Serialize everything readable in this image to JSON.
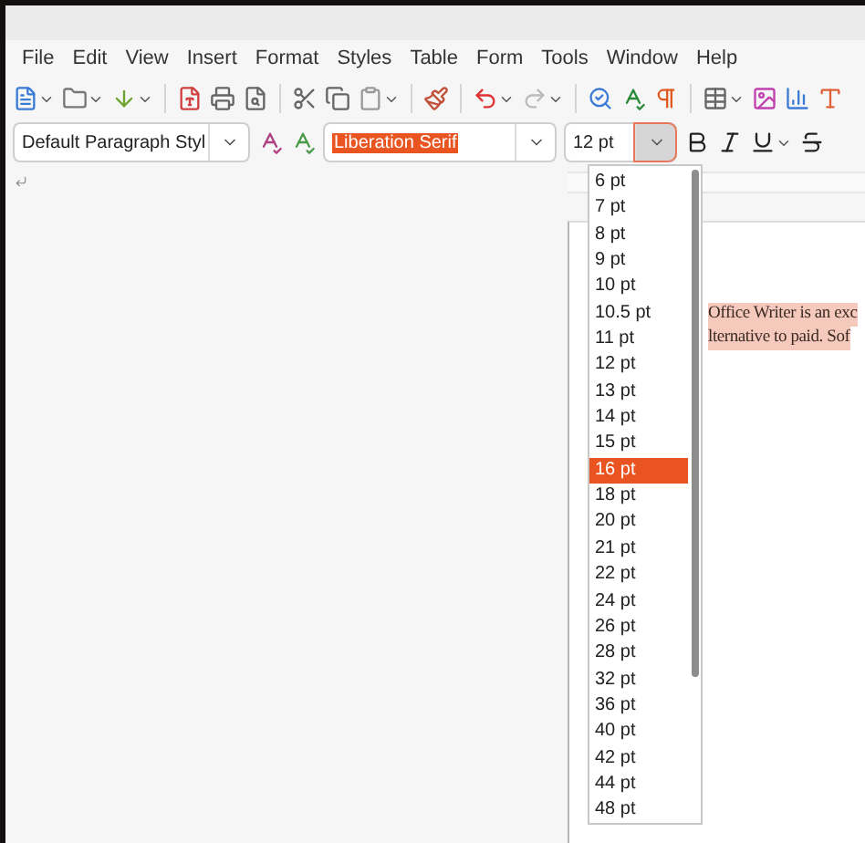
{
  "menu": [
    "File",
    "Edit",
    "View",
    "Insert",
    "Format",
    "Styles",
    "Table",
    "Form",
    "Tools",
    "Window",
    "Help"
  ],
  "paragraph_style": {
    "value": "Default Paragraph Styl"
  },
  "font_name": {
    "value": "Liberation Serif",
    "text_selected": true
  },
  "font_size": {
    "value": "12 pt",
    "dropdown_open": true
  },
  "size_list": [
    {
      "label": "6 pt",
      "selected": false
    },
    {
      "label": "7 pt",
      "selected": false
    },
    {
      "label": "8 pt",
      "selected": false
    },
    {
      "label": "9 pt",
      "selected": false
    },
    {
      "label": "10 pt",
      "selected": false
    },
    {
      "label": "10.5 pt",
      "selected": false
    },
    {
      "label": "11 pt",
      "selected": false
    },
    {
      "label": "12 pt",
      "selected": false
    },
    {
      "label": "13 pt",
      "selected": false
    },
    {
      "label": "14 pt",
      "selected": false
    },
    {
      "label": "15 pt",
      "selected": false
    },
    {
      "label": "16 pt",
      "selected": true
    },
    {
      "label": "18 pt",
      "selected": false
    },
    {
      "label": "20 pt",
      "selected": false
    },
    {
      "label": "21 pt",
      "selected": false
    },
    {
      "label": "22 pt",
      "selected": false
    },
    {
      "label": "24 pt",
      "selected": false
    },
    {
      "label": "26 pt",
      "selected": false
    },
    {
      "label": "28 pt",
      "selected": false
    },
    {
      "label": "32 pt",
      "selected": false
    },
    {
      "label": "36 pt",
      "selected": false
    },
    {
      "label": "40 pt",
      "selected": false
    },
    {
      "label": "42 pt",
      "selected": false
    },
    {
      "label": "44 pt",
      "selected": false
    },
    {
      "label": "48 pt",
      "selected": false
    }
  ],
  "document": {
    "lines": [
      {
        "text": "Office Writer is an exc",
        "highlighted": true
      },
      {
        "text": "lternative to paid. Sof",
        "highlighted": true
      }
    ]
  }
}
